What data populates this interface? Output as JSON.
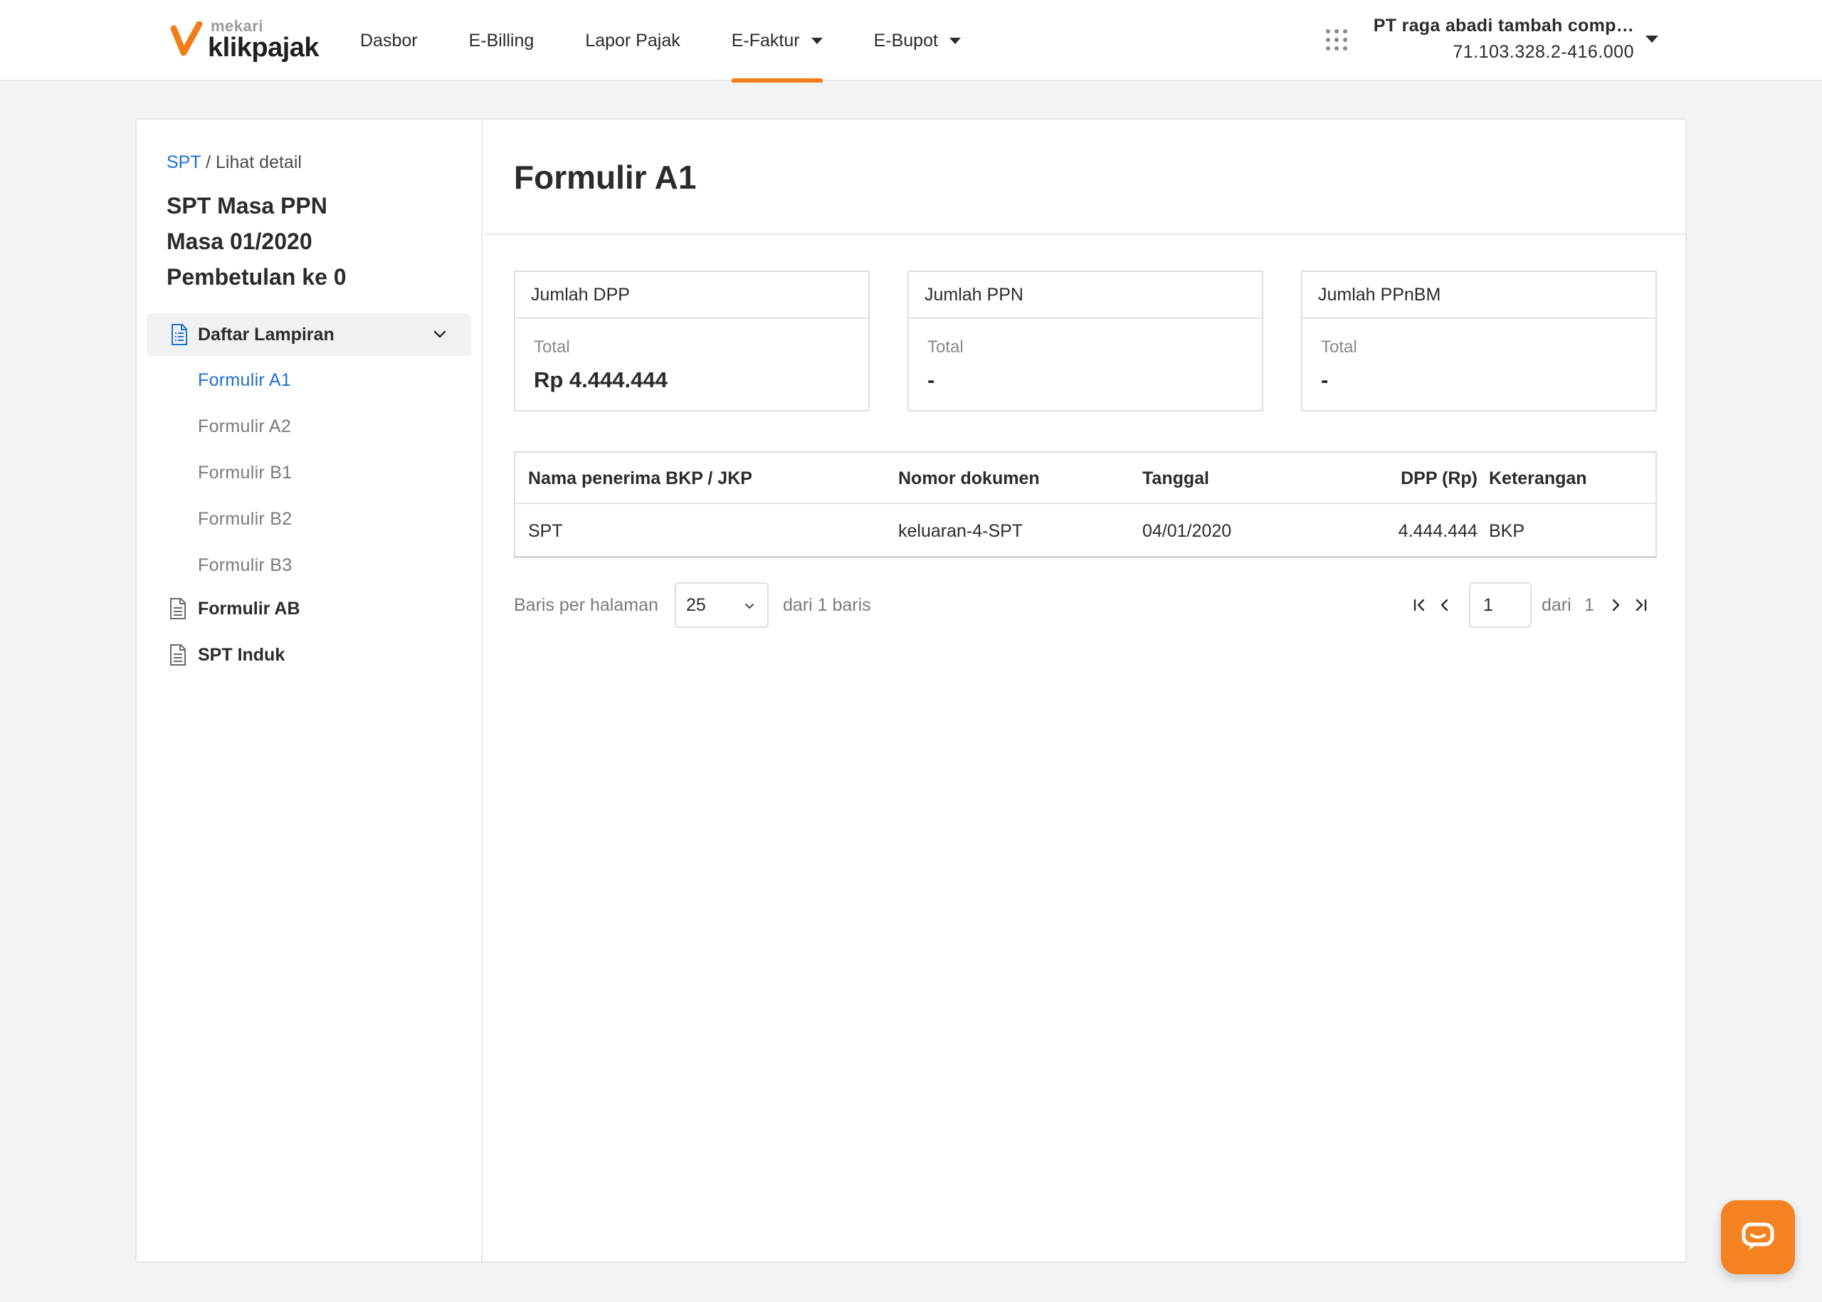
{
  "brand": {
    "small": "mekari",
    "big": "klikpajak",
    "accent": "#f07d1a"
  },
  "nav": {
    "items": [
      {
        "label": "Dasbor"
      },
      {
        "label": "E-Billing"
      },
      {
        "label": "Lapor Pajak"
      },
      {
        "label": "E-Faktur",
        "active": true,
        "dropdown": true
      },
      {
        "label": "E-Bupot",
        "dropdown": true
      }
    ]
  },
  "company": {
    "name": "PT raga abadi tambah comp…",
    "npwp": "71.103.328.2-416.000"
  },
  "sidebar": {
    "breadcrumb_link": "SPT",
    "breadcrumb_rest": "/ Lihat detail",
    "title_line1": "SPT Masa PPN",
    "title_line2": "Masa 01/2020",
    "title_line3": "Pembetulan ke 0",
    "group_label": "Daftar Lampiran",
    "sub_items": [
      {
        "label": "Formulir A1",
        "active": true
      },
      {
        "label": "Formulir A2"
      },
      {
        "label": "Formulir B1"
      },
      {
        "label": "Formulir B2"
      },
      {
        "label": "Formulir B3"
      }
    ],
    "items": [
      {
        "label": "Formulir AB"
      },
      {
        "label": "SPT Induk"
      }
    ]
  },
  "main": {
    "title": "Formulir A1",
    "cards": [
      {
        "header": "Jumlah DPP",
        "sub": "Total",
        "value": "Rp 4.444.444"
      },
      {
        "header": "Jumlah PPN",
        "sub": "Total",
        "value": "-"
      },
      {
        "header": "Jumlah PPnBM",
        "sub": "Total",
        "value": "-"
      }
    ],
    "table": {
      "columns": [
        "Nama penerima BKP / JKP",
        "Nomor dokumen",
        "Tanggal",
        "DPP (Rp)",
        "Keterangan"
      ],
      "rows": [
        [
          "SPT",
          "keluaran-4-SPT",
          "04/01/2020",
          "4.444.444",
          "BKP"
        ]
      ]
    },
    "pagination": {
      "rows_label": "Baris per halaman",
      "rows_value": "25",
      "total_label": "dari 1 baris",
      "page_value": "1",
      "of_label": "dari",
      "page_total": "1"
    }
  },
  "icons": {
    "apps": "apps-grid-icon",
    "chat": "chat-icon"
  }
}
